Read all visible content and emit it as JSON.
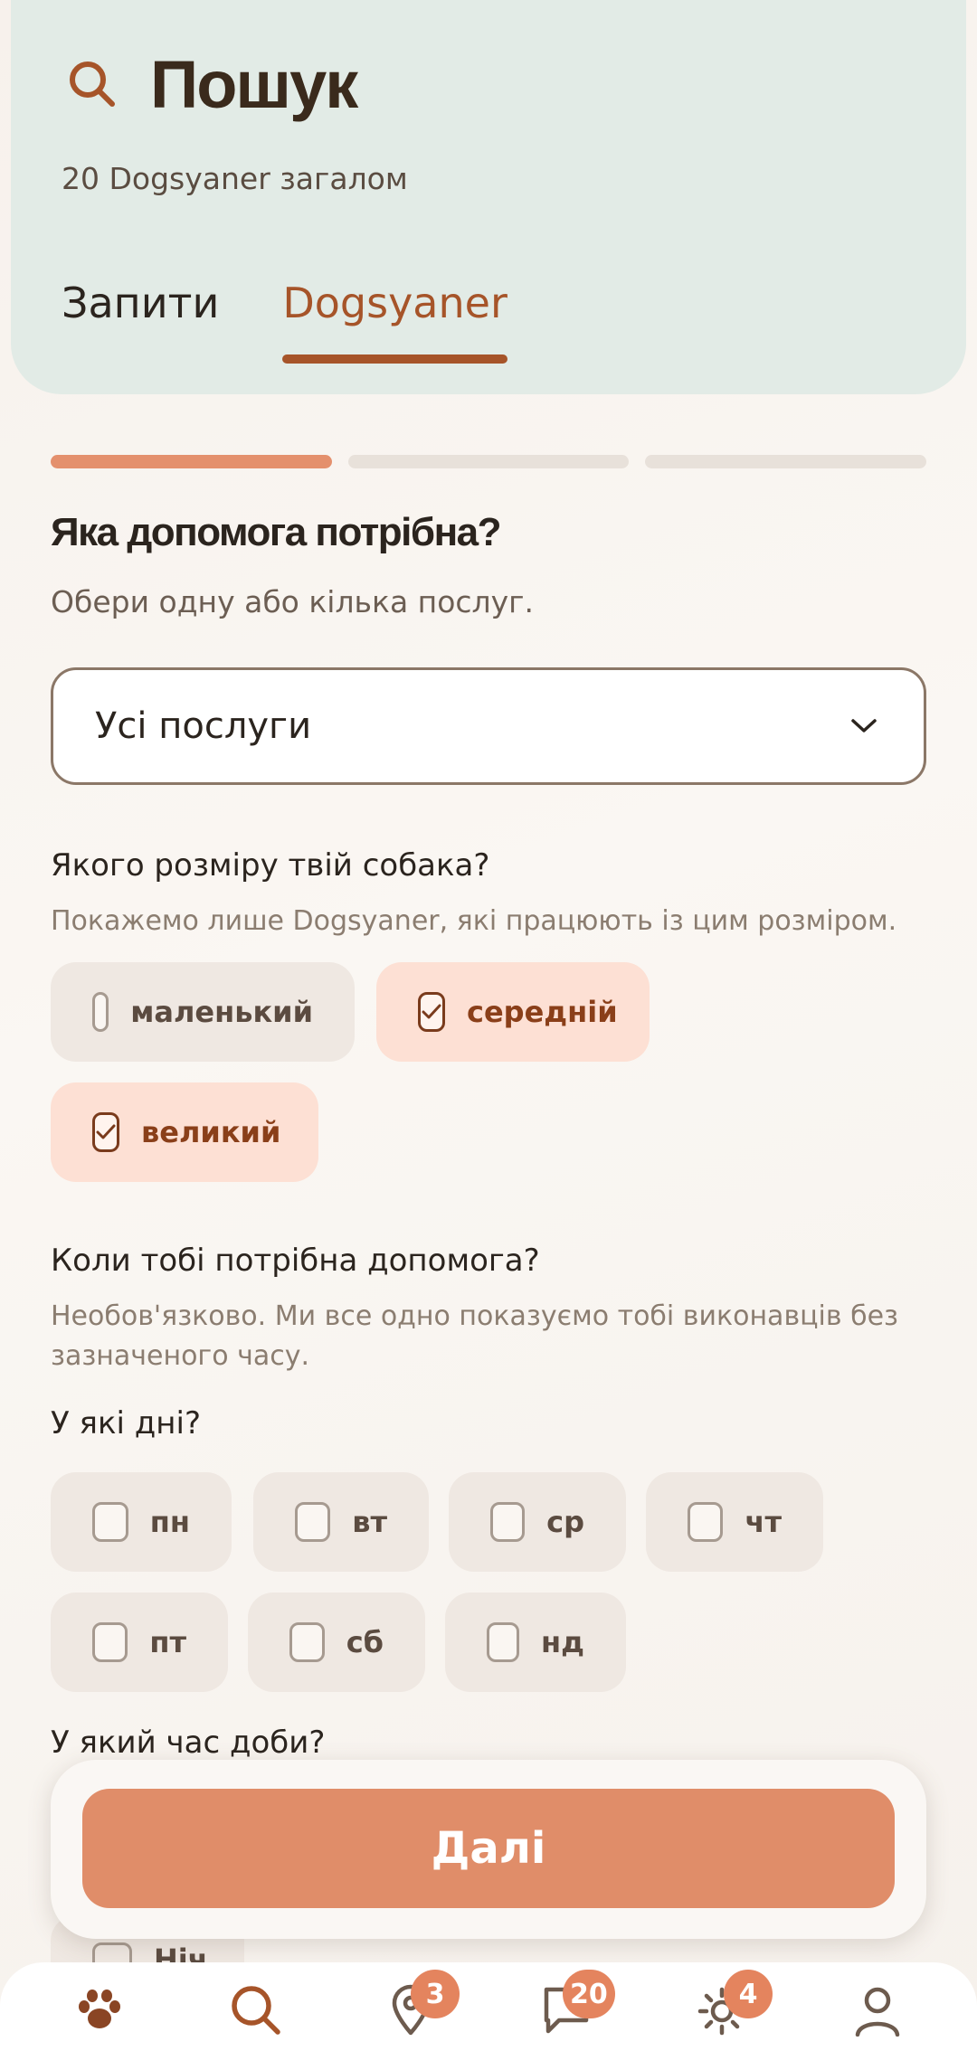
{
  "header": {
    "title": "Пошук",
    "subtitle": "20 Dogsyaner загалом",
    "tabs": [
      {
        "label": "Запити",
        "active": false
      },
      {
        "label": "Dogsyaner",
        "active": true
      }
    ]
  },
  "progress": {
    "current_step": 1,
    "total_steps": 3
  },
  "services": {
    "question": "Яка допомога потрібна?",
    "hint": "Обери одну або кілька послуг.",
    "selected": "Усі послуги"
  },
  "size": {
    "question": "Якого розміру твій собака?",
    "hint": "Покажемо лише Dogsyaner, які працюють із цим розміром.",
    "options": [
      {
        "label": "маленький",
        "checked": false
      },
      {
        "label": "середній",
        "checked": true
      },
      {
        "label": "великий",
        "checked": true
      }
    ]
  },
  "when": {
    "question": "Коли тобі потрібна допомога?",
    "hint": "Необов'язково. Ми все одно показуємо тобі виконавців без зазначеного часу.",
    "days_label": "У які дні?",
    "days": [
      {
        "label": "пн",
        "checked": false
      },
      {
        "label": "вт",
        "checked": false
      },
      {
        "label": "ср",
        "checked": false
      },
      {
        "label": "чт",
        "checked": false
      },
      {
        "label": "пт",
        "checked": false
      },
      {
        "label": "сб",
        "checked": false
      },
      {
        "label": "нд",
        "checked": false
      }
    ],
    "time_label": "У який час доби?",
    "time_partial_option": "Ніч"
  },
  "next_button": "Далі",
  "nav": {
    "items": [
      {
        "icon": "paw-icon",
        "badge": ""
      },
      {
        "icon": "search-icon",
        "badge": ""
      },
      {
        "icon": "map-pin-icon",
        "badge": "3"
      },
      {
        "icon": "chat-icon",
        "badge": "20"
      },
      {
        "icon": "sun-icon",
        "badge": "4"
      },
      {
        "icon": "profile-icon",
        "badge": ""
      }
    ]
  },
  "colors": {
    "accent": "#e08d69",
    "accent_dark": "#a65429",
    "header_bg": "#e2ebe6",
    "chip_checked_bg": "#fde0d4"
  }
}
